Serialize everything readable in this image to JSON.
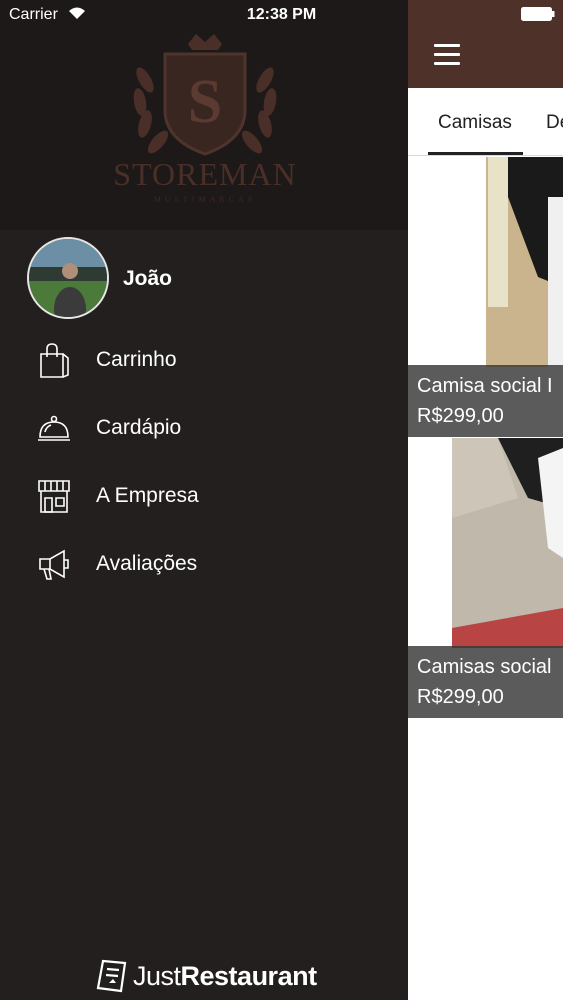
{
  "status_bar": {
    "carrier": "Carrier",
    "time": "12:38 PM"
  },
  "drawer": {
    "logo_text": "STOREMAN",
    "logo_subtext": "MULTIMARCAS",
    "logo_letter": "S",
    "user_name": "João",
    "menu": [
      {
        "label": "Carrinho",
        "icon": "shopping-bag-icon"
      },
      {
        "label": "Cardápio",
        "icon": "cloche-icon"
      },
      {
        "label": "A Empresa",
        "icon": "storefront-icon"
      },
      {
        "label": "Avaliações",
        "icon": "megaphone-icon"
      }
    ],
    "footer": {
      "prefix": "Just",
      "brand": "Restaurant"
    }
  },
  "main": {
    "tabs": [
      {
        "label": "Camisas",
        "active": true
      },
      {
        "label": "De"
      }
    ],
    "products": [
      {
        "name": "Camisa social I",
        "price": "R$299,00"
      },
      {
        "name": "Camisas social",
        "price": "R$299,00"
      }
    ]
  },
  "colors": {
    "accent": "#4e3229",
    "drawer_bg": "#231f1e",
    "logo": "#5a3a31"
  }
}
